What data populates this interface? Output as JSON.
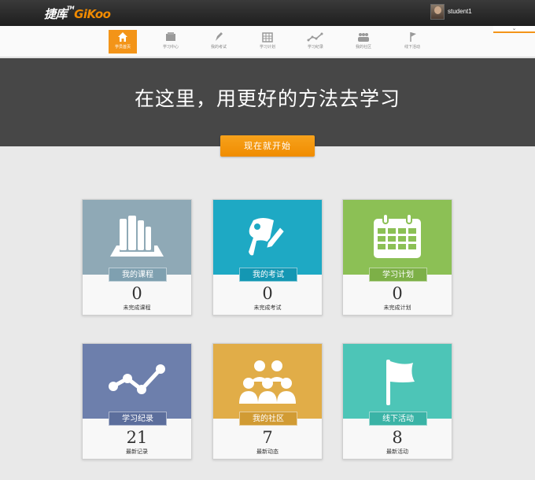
{
  "header": {
    "logo_cn": "捷库",
    "logo_en": "GiKoo",
    "logo_tm": "TM",
    "username": "student1"
  },
  "nav": {
    "items": [
      {
        "label": "学员首页",
        "icon": "home-icon",
        "active": true
      },
      {
        "label": "学习中心",
        "icon": "book-icon",
        "active": false
      },
      {
        "label": "我的考试",
        "icon": "pen-icon",
        "active": false
      },
      {
        "label": "学习计划",
        "icon": "calendar-icon",
        "active": false
      },
      {
        "label": "学习纪录",
        "icon": "chart-line-icon",
        "active": false
      },
      {
        "label": "我的社区",
        "icon": "people-icon",
        "active": false
      },
      {
        "label": "线下活动",
        "icon": "flag-icon",
        "active": false
      }
    ],
    "dropdown_glyph": "⌄"
  },
  "hero": {
    "title": "在这里，用更好的方法去学习",
    "button_label": "现在就开始"
  },
  "cards": [
    {
      "title": "我的课程",
      "count": "0",
      "subtitle": "未完成课程",
      "color": "#8fa9b6",
      "tag_color": "#7fa0b0",
      "icon": "books-icon"
    },
    {
      "title": "我的考试",
      "count": "0",
      "subtitle": "未完成考试",
      "color": "#1ea9c4",
      "tag_color": "#1497b3",
      "icon": "exam-pen-icon"
    },
    {
      "title": "学习计划",
      "count": "0",
      "subtitle": "未完成计划",
      "color": "#8cc055",
      "tag_color": "#7db047",
      "icon": "calendar-icon"
    },
    {
      "title": "学习纪录",
      "count": "21",
      "subtitle": "最新记录",
      "color": "#6d7fac",
      "tag_color": "#5c6e9c",
      "icon": "chart-line-icon"
    },
    {
      "title": "我的社区",
      "count": "7",
      "subtitle": "最新动态",
      "color": "#e1ad48",
      "tag_color": "#d19b34",
      "icon": "people-icon"
    },
    {
      "title": "线下活动",
      "count": "8",
      "subtitle": "最新活动",
      "color": "#4dc5b7",
      "tag_color": "#3ab3a6",
      "icon": "flag-icon"
    }
  ],
  "colors": {
    "accent": "#f39418",
    "hero_bg": "#474747",
    "header_bg": "#2a2a2a"
  }
}
